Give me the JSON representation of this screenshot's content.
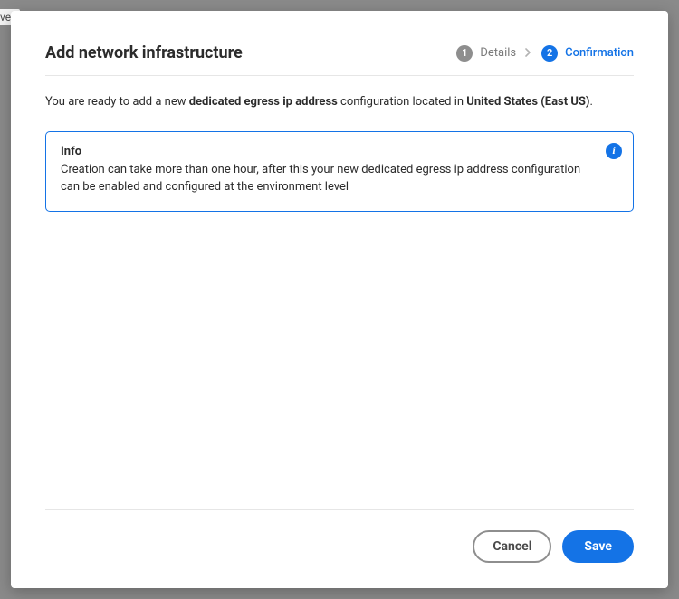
{
  "backdrop_fragment": "ver",
  "title": "Add network infrastructure",
  "steps": {
    "s1": {
      "num": "1",
      "label": "Details"
    },
    "s2": {
      "num": "2",
      "label": "Confirmation"
    }
  },
  "intro": {
    "prefix": "You are ready to add a new ",
    "config_type": "dedicated egress ip address",
    "middle": " configuration located in ",
    "region": "United States (East US)",
    "suffix": "."
  },
  "info": {
    "title": "Info",
    "body": "Creation can take more than one hour, after this your new dedicated egress ip address configuration can be enabled and configured at the environment level",
    "icon_glyph": "i"
  },
  "footer": {
    "cancel": "Cancel",
    "save": "Save"
  }
}
